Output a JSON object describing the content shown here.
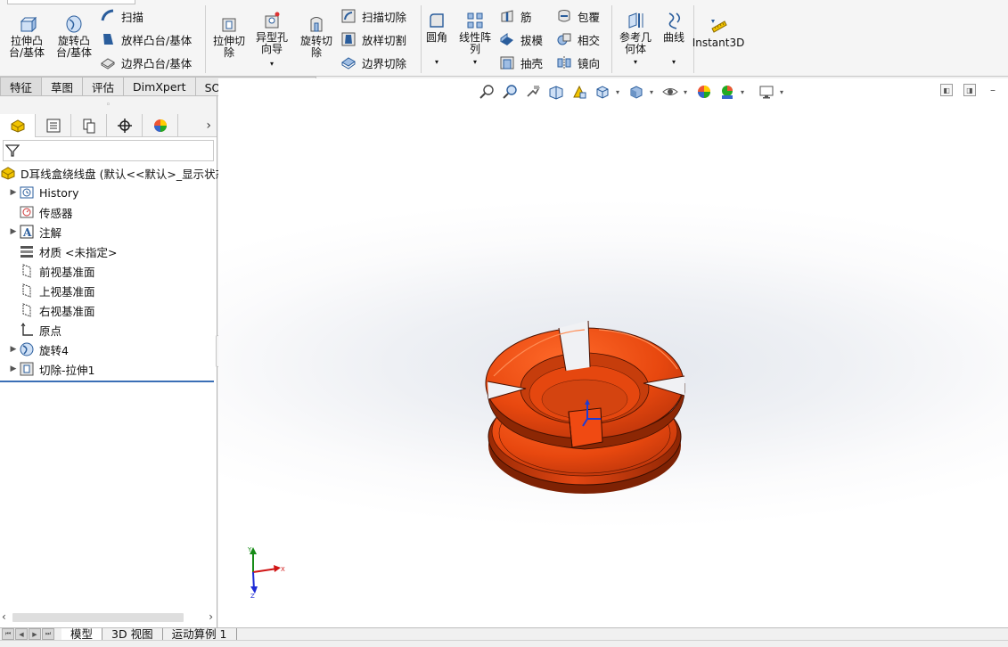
{
  "ribbon": {
    "extrude_boss": "拉伸凸\n台/基体",
    "revolve_boss": "旋转凸\n台/基体",
    "sweep": "扫描",
    "loft_boss": "放样凸台/基体",
    "boundary_boss": "边界凸台/基体",
    "extrude_cut": "拉伸切\n除",
    "hole_wizard": "异型孔\n向导",
    "revolve_cut": "旋转切\n除",
    "sweep_cut": "扫描切除",
    "loft_cut": "放样切割",
    "boundary_cut": "边界切除",
    "fillet": "圆角",
    "linear_pattern": "线性阵\n列",
    "rib": "筋",
    "draft": "拔模",
    "shell": "抽壳",
    "wrap": "包覆",
    "intersect": "相交",
    "mirror": "镜向",
    "reference_geometry": "参考几\n何体",
    "curves": "曲线",
    "instant3d": "Instant3D",
    "dropdown_arrow": "▾"
  },
  "tabs": [
    "特征",
    "草图",
    "评估",
    "DimXpert",
    "SOLIDWORKS 插件"
  ],
  "left_panel": {
    "grip": "◦",
    "expand_arrow": "›",
    "tree": {
      "root": "D耳线盒绕线盘 (默认<<默认>_显示状态",
      "items": [
        {
          "label": "History",
          "icon": "history-icon",
          "expandable": true
        },
        {
          "label": "传感器",
          "icon": "sensor-icon",
          "expandable": false
        },
        {
          "label": "注解",
          "icon": "annotation-icon",
          "expandable": true
        },
        {
          "label": "材质 <未指定>",
          "icon": "material-icon",
          "expandable": false
        },
        {
          "label": "前视基准面",
          "icon": "plane-icon",
          "expandable": false
        },
        {
          "label": "上视基准面",
          "icon": "plane-icon",
          "expandable": false
        },
        {
          "label": "右视基准面",
          "icon": "plane-icon",
          "expandable": false
        },
        {
          "label": "原点",
          "icon": "origin-icon",
          "expandable": false
        },
        {
          "label": "旋转4",
          "icon": "revolve-feature-icon",
          "expandable": true
        },
        {
          "label": "切除-拉伸1",
          "icon": "cut-extrude-feature-icon",
          "expandable": true
        }
      ]
    }
  },
  "bottom_tabs": [
    "模型",
    "3D 视图",
    "运动算例 1"
  ],
  "triad": {
    "x": "X",
    "y": "Y",
    "z": "Z"
  },
  "colors": {
    "part_orange": "#e94a12",
    "part_dark": "#a52a06",
    "accent_blue": "#3b6fb6"
  }
}
